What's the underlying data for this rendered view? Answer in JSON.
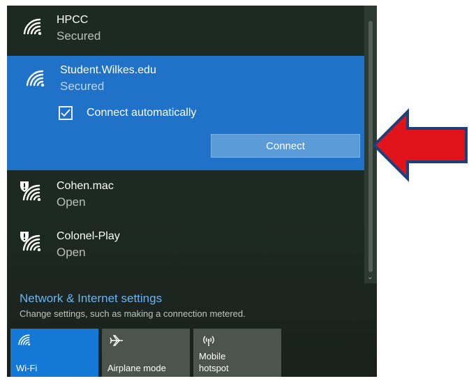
{
  "networks": [
    {
      "name": "HPCC",
      "status": "Secured",
      "icon": "wifi-icon"
    },
    {
      "name": "Student.Wilkes.edu",
      "status": "Secured",
      "icon": "wifi-icon",
      "selected": true
    },
    {
      "name": "Cohen.mac",
      "status": "Open",
      "icon": "wifi-open-shield-icon"
    },
    {
      "name": "Colonel-Play",
      "status": "Open",
      "icon": "wifi-open-shield-icon"
    }
  ],
  "selected_network": {
    "connect_automatically_label": "Connect automatically",
    "connect_automatically_checked": true,
    "connect_button_label": "Connect"
  },
  "settings": {
    "title": "Network & Internet settings",
    "subtitle": "Change settings, such as making a connection metered."
  },
  "quick_actions": [
    {
      "label": "Wi-Fi",
      "icon": "wifi-icon",
      "active": true
    },
    {
      "label": "Airplane mode",
      "icon": "airplane-icon",
      "active": false
    },
    {
      "label_line1": "Mobile",
      "label_line2": "hotspot",
      "icon": "hotspot-icon",
      "active": false
    }
  ],
  "colors": {
    "selected_bg": "#1f72c8",
    "accent_link": "#6cb4f0",
    "active_tile": "#1479d6",
    "inactive_tile": "#4d5450",
    "annotation_arrow": "#e0121a"
  }
}
